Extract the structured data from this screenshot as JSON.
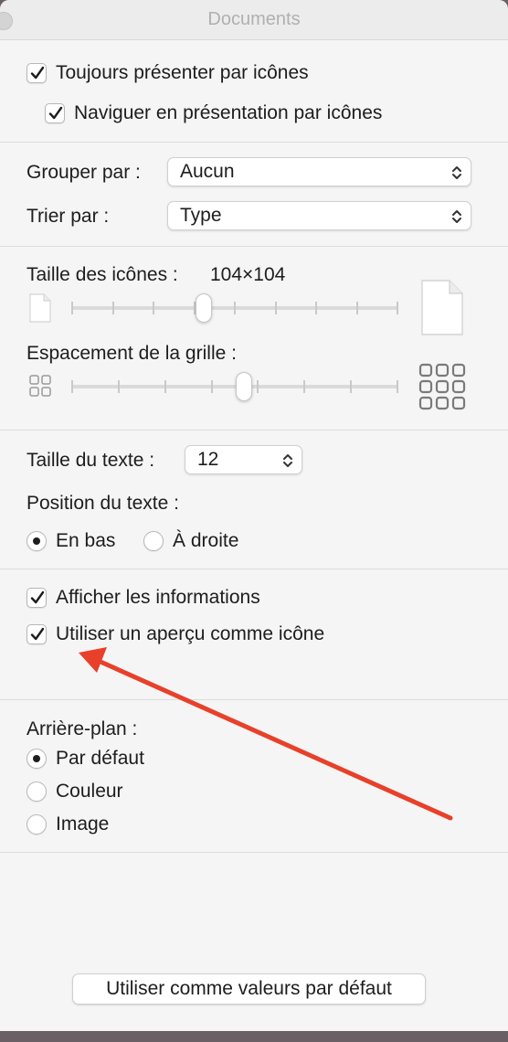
{
  "window": {
    "title": "Documents"
  },
  "view_options": {
    "always_icons": {
      "label": "Toujours présenter par icônes",
      "checked": true
    },
    "browse_icons": {
      "label": "Naviguer en présentation par icônes",
      "checked": true
    }
  },
  "grouping": {
    "group_label": "Grouper par :",
    "group_value": "Aucun",
    "sort_label": "Trier par :",
    "sort_value": "Type"
  },
  "icon_size": {
    "label": "Taille des icônes :",
    "value_text": "104×104",
    "level": 0.4,
    "small_icon": "document-small-icon",
    "large_icon": "document-large-icon"
  },
  "grid_spacing": {
    "label": "Espacement de la grille :",
    "level": 0.53,
    "small_icon": "grid-small-icon",
    "large_icon": "grid-large-icon"
  },
  "text": {
    "size_label": "Taille du texte :",
    "size_value": "12",
    "position_label": "Position du texte :",
    "bottom_label": "En bas",
    "right_label": "À droite",
    "selected": "bottom"
  },
  "info": {
    "show_info": {
      "label": "Afficher les informations",
      "checked": true
    },
    "preview_icon": {
      "label": "Utiliser un aperçu comme icône",
      "checked": true
    }
  },
  "background": {
    "label": "Arrière-plan :",
    "options": [
      "Par défaut",
      "Couleur",
      "Image"
    ],
    "selected": "Par défaut"
  },
  "footer": {
    "default_button": "Utiliser comme valeurs par défaut"
  },
  "annotation": {
    "arrow_color": "#e8402a"
  }
}
